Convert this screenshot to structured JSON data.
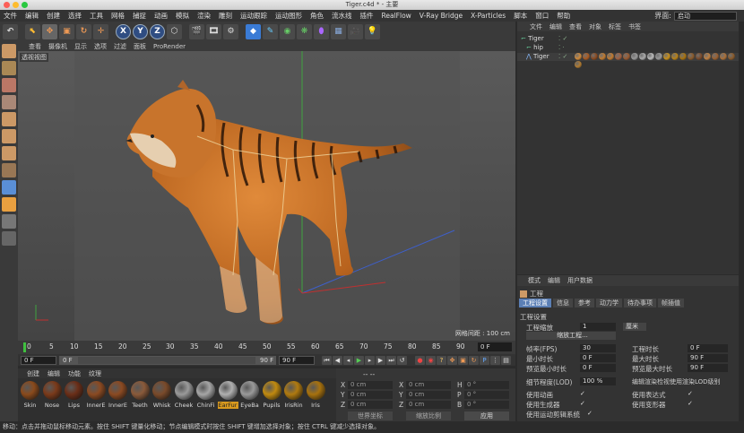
{
  "window": {
    "title": "Tiger.c4d * - 主要"
  },
  "menubar": {
    "items": [
      "文件",
      "编辑",
      "创建",
      "选择",
      "工具",
      "网格",
      "捕捉",
      "动画",
      "模拟",
      "渲染",
      "雕刻",
      "运动跟踪",
      "运动图形",
      "角色",
      "流水线",
      "插件",
      "RealFlow",
      "V-Ray Bridge",
      "X-Particles",
      "脚本",
      "窗口",
      "帮助"
    ],
    "layout_label": "界面:",
    "layout_value": "启动"
  },
  "toolbar": {
    "axis_buttons": [
      "X",
      "Y",
      "Z"
    ]
  },
  "viewport": {
    "menu": [
      "查看",
      "摄像机",
      "显示",
      "选项",
      "过滤",
      "面板",
      "ProRender"
    ],
    "label": "透视视图",
    "grid_distance": "网格间距 : 100 cm"
  },
  "timeline": {
    "ticks": [
      "0",
      "5",
      "10",
      "15",
      "20",
      "25",
      "30",
      "35",
      "40",
      "45",
      "50",
      "55",
      "60",
      "65",
      "70",
      "75",
      "80",
      "85",
      "90"
    ],
    "current_frame": "0 F"
  },
  "transport": {
    "start": "0 F",
    "min_field": "0 F",
    "max_field": "90 F",
    "end": "90 F"
  },
  "materials": {
    "menu": [
      "创建",
      "编辑",
      "功能",
      "纹理"
    ],
    "items": [
      {
        "name": "Skin",
        "color": "#8a4a1c"
      },
      {
        "name": "Nose",
        "color": "#7a3a1a"
      },
      {
        "name": "Lips",
        "color": "#6a2e18"
      },
      {
        "name": "InnerE",
        "color": "#8b4a22"
      },
      {
        "name": "InnerE",
        "color": "#8b4a22"
      },
      {
        "name": "Teeth",
        "color": "#8a5a3a"
      },
      {
        "name": "Whisk",
        "color": "#7a4a2a"
      },
      {
        "name": "Cheek",
        "color": "#9a9a9a"
      },
      {
        "name": "ChinFi",
        "color": "#a6a6a6"
      },
      {
        "name": "EarFur",
        "color": "#b0b0b0"
      },
      {
        "name": "EyeBa",
        "color": "#9a9a9a"
      },
      {
        "name": "Pupils",
        "color": "#c08a10"
      },
      {
        "name": "IrisRin",
        "color": "#b07a10"
      },
      {
        "name": "Iris",
        "color": "#a8720e"
      }
    ],
    "active_index": 9
  },
  "coords": {
    "header": "-- --",
    "rows": [
      {
        "a": "X",
        "av": "0 cm",
        "b": "X",
        "bv": "0 cm",
        "c": "H",
        "cv": "0 °"
      },
      {
        "a": "Y",
        "av": "0 cm",
        "b": "Y",
        "bv": "0 cm",
        "c": "P",
        "cv": "0 °"
      },
      {
        "a": "Z",
        "av": "0 cm",
        "b": "Z",
        "bv": "0 cm",
        "c": "B",
        "cv": "0 °"
      }
    ],
    "mode_select": "世界坐标",
    "scale_select": "缩放比例",
    "apply": "应用"
  },
  "objects": {
    "menu": [
      "文件",
      "编辑",
      "查看",
      "对象",
      "标签",
      "书签"
    ],
    "rows": [
      {
        "name": "Tiger",
        "indent": 0
      },
      {
        "name": "hip",
        "indent": 1
      },
      {
        "name": "Tiger",
        "indent": 1
      }
    ]
  },
  "attributes": {
    "menu": [
      "模式",
      "编辑",
      "用户数据"
    ],
    "section_title": "工程",
    "tabs": [
      "工程设置",
      "信息",
      "参考",
      "动力学",
      "待办事项",
      "帧插值"
    ],
    "group_title": "工程设置",
    "project_scale_label": "工程缩放",
    "project_scale_value": "1",
    "project_scale_unit": "厘米",
    "scale_button": "缩放工程...",
    "fps_label": "帧率(FPS)",
    "fps_value": "30",
    "min_time_label": "最小时长",
    "min_time_value": "0 F",
    "preview_min_label": "预览最小时长",
    "preview_min_value": "0 F",
    "lod_label": "细节程度(LOD)",
    "lod_value": "100 %",
    "project_time_label": "工程时长",
    "project_time_value": "0 F",
    "max_time_label": "最大时长",
    "max_time_value": "90 F",
    "preview_max_label": "预览最大时长",
    "preview_max_value": "90 F",
    "lod_render_label": "编辑渲染检视使用渲染LOD级别",
    "use_anim_label": "使用动画",
    "use_expr_label": "使用表达式",
    "use_gen_label": "使用生成器",
    "use_deform_label": "使用变形器",
    "use_mograph_label": "使用运动剪辑系统"
  },
  "status": {
    "text": "移动：点击并拖动鼠标移动元素。按住 SHIFT 键量化移动；节点编辑模式时按住 SHIFT 键增加选择对象；按住 CTRL 键减少选择对象。"
  },
  "colors": {
    "accent": "#5b7fb5",
    "active_material": "#d99a1e",
    "viewport_bg": "#4d4d4d"
  }
}
